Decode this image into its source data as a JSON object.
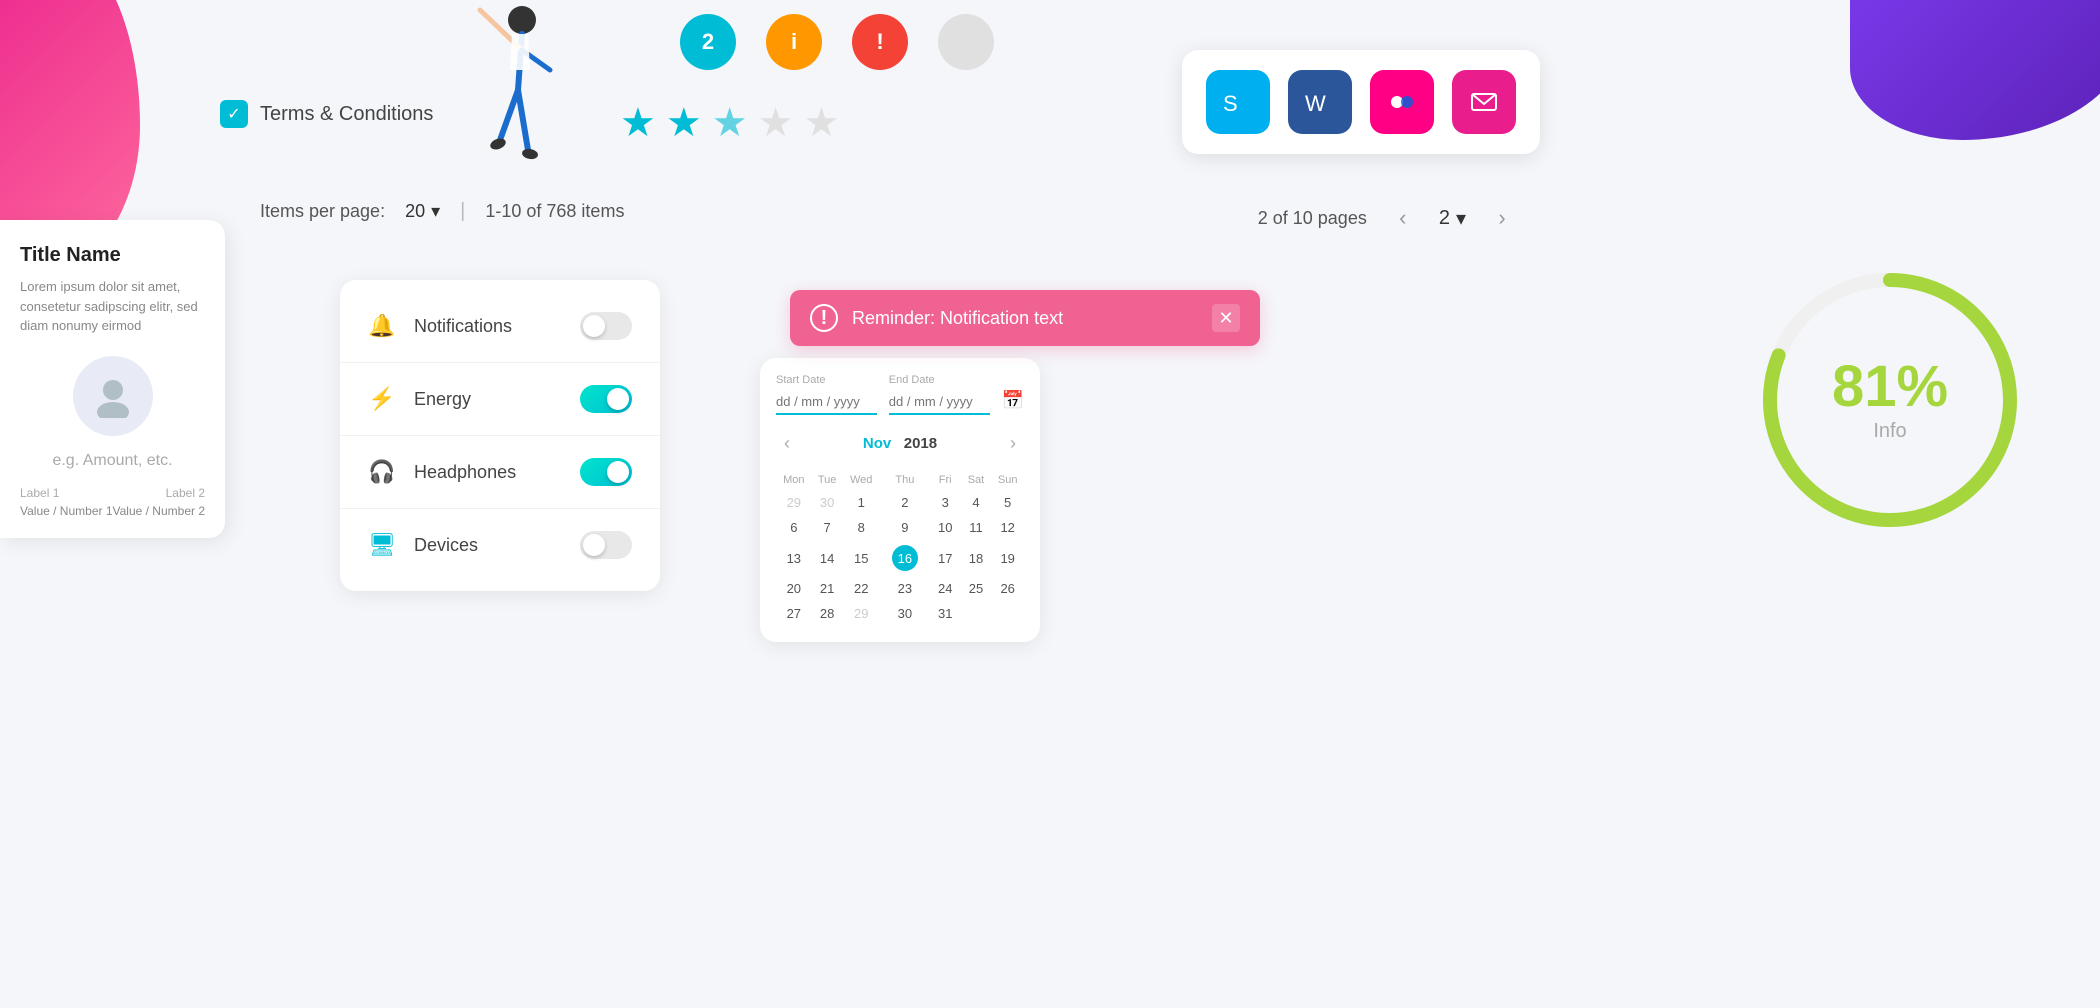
{
  "blobs": {
    "pink": "decorative",
    "purple": "decorative"
  },
  "terms": {
    "label": "Terms & Conditions"
  },
  "status_icons": [
    {
      "id": "teal",
      "text": "2",
      "color": "teal"
    },
    {
      "id": "orange",
      "text": "i",
      "color": "orange"
    },
    {
      "id": "red",
      "text": "!",
      "color": "red"
    },
    {
      "id": "gray",
      "text": "",
      "color": "gray"
    }
  ],
  "stars": {
    "filled": 2,
    "half": 1,
    "empty": 2
  },
  "pagination": {
    "label": "Items per page:",
    "per_page": "20",
    "range": "1-10 of 768 items",
    "pages_label": "2 of 10 pages",
    "current_page": "2"
  },
  "card": {
    "title": "Title Name",
    "description": "Lorem ipsum dolor sit amet, consetetur sadipscing elitr, sed diam nonumy eirmod",
    "amount_placeholder": "e.g. Amount, etc.",
    "label1": "Label 1",
    "label2": "Label 2",
    "value1": "Value / Number 1",
    "value2": "Value / Number 2"
  },
  "settings": {
    "items": [
      {
        "id": "notifications",
        "label": "Notifications",
        "icon": "🔔",
        "toggle": false
      },
      {
        "id": "energy",
        "label": "Energy",
        "icon": "⚡",
        "toggle": true
      },
      {
        "id": "headphones",
        "label": "Headphones",
        "icon": "🎧",
        "toggle": true
      },
      {
        "id": "devices",
        "label": "Devices",
        "icon": "🖥",
        "toggle": false
      }
    ]
  },
  "notification": {
    "text": "Reminder: Notification text",
    "icon": "!"
  },
  "calendar": {
    "start_date_label": "Start Date",
    "end_date_label": "End Date",
    "placeholder": "dd / mm / yyyy",
    "month": "Nov",
    "year": "2018",
    "days_header": [
      "Mon",
      "Tue",
      "Wed",
      "Thu",
      "Fri",
      "Sat",
      "Sun"
    ],
    "weeks": [
      [
        "29",
        "30",
        "1",
        "2",
        "3",
        "4",
        "5"
      ],
      [
        "6",
        "7",
        "8",
        "9",
        "10",
        "11",
        "12"
      ],
      [
        "13",
        "14",
        "15",
        "16",
        "17",
        "18",
        "19"
      ],
      [
        "20",
        "21",
        "22",
        "23",
        "24",
        "25",
        "26"
      ],
      [
        "27",
        "28",
        "29",
        "30",
        "31",
        "",
        ""
      ]
    ],
    "today": "16",
    "prev_btn": "‹",
    "next_btn": "›"
  },
  "app_icons": [
    {
      "id": "skype",
      "label": "Skype",
      "symbol": "S"
    },
    {
      "id": "word",
      "label": "Word",
      "symbol": "W"
    },
    {
      "id": "flickr",
      "label": "Flickr",
      "symbol": "f"
    },
    {
      "id": "mail",
      "label": "Mail",
      "symbol": "✉"
    }
  ],
  "progress": {
    "percent": "81%",
    "label": "Info",
    "value": 81
  }
}
